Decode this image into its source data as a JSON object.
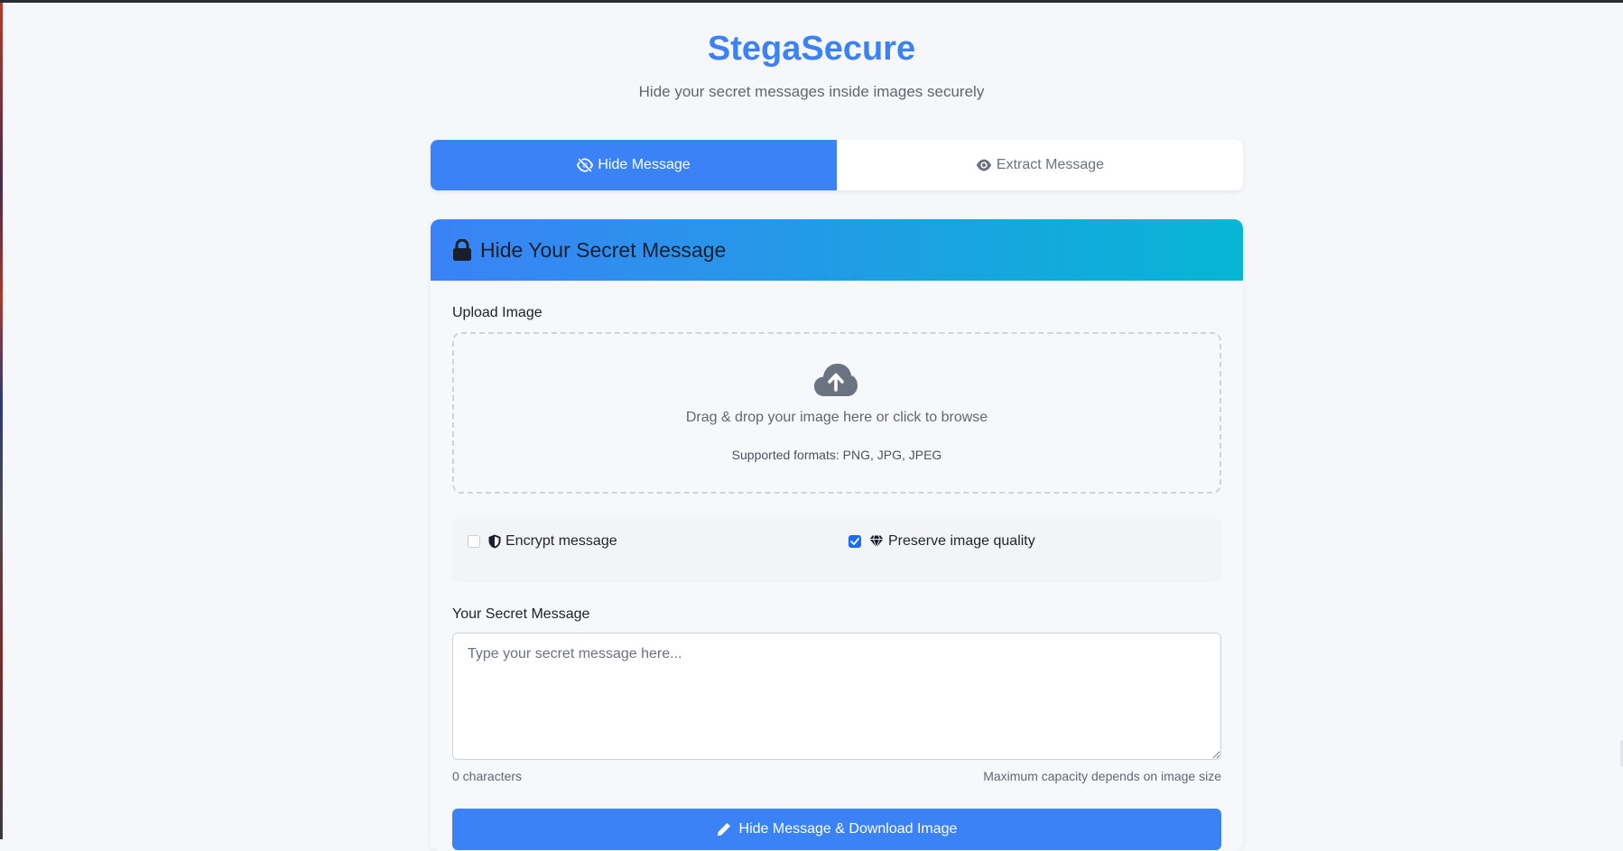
{
  "header": {
    "title": "StegaSecure",
    "subtitle": "Hide your secret messages inside images securely"
  },
  "tabs": [
    {
      "label": "Hide Message",
      "icon": "eye-slash-icon",
      "active": true
    },
    {
      "label": "Extract Message",
      "icon": "eye-icon",
      "active": false
    }
  ],
  "card": {
    "title": "Hide Your Secret Message",
    "icon": "lock-icon"
  },
  "upload": {
    "label": "Upload Image",
    "icon": "cloud-upload-icon",
    "prompt": "Drag & drop your image here or click to browse",
    "formats": "Supported formats: PNG, JPG, JPEG"
  },
  "options": {
    "encrypt": {
      "label": "Encrypt message",
      "icon": "shield-icon",
      "checked": false
    },
    "preserve": {
      "label": "Preserve image quality",
      "icon": "gem-icon",
      "checked": true
    }
  },
  "message": {
    "label": "Your Secret Message",
    "placeholder": "Type your secret message here...",
    "value": "",
    "char_count": "0 characters",
    "capacity_note": "Maximum capacity depends on image size"
  },
  "submit": {
    "label": "Hide Message & Download Image",
    "icon": "pen-icon"
  },
  "colors": {
    "primary": "#3b82f6",
    "gradient_end": "#06b6d4",
    "checkbox_checked": "#1a6ef5"
  }
}
